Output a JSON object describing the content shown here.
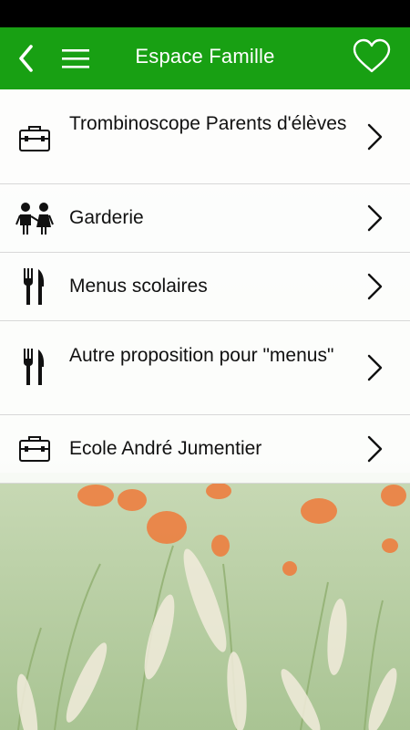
{
  "header": {
    "title": "Espace Famille"
  },
  "items": [
    {
      "label": "Trombinoscope Parents d'élèves",
      "icon": "briefcase-icon"
    },
    {
      "label": "Garderie",
      "icon": "children-icon"
    },
    {
      "label": "Menus scolaires",
      "icon": "cutlery-icon"
    },
    {
      "label": "Autre proposition pour \"menus\"",
      "icon": "cutlery-icon"
    },
    {
      "label": "Ecole André Jumentier",
      "icon": "briefcase-icon"
    }
  ],
  "colors": {
    "header": "#18a013",
    "background": "#e9efe4",
    "poppy": "#f07a3a"
  }
}
